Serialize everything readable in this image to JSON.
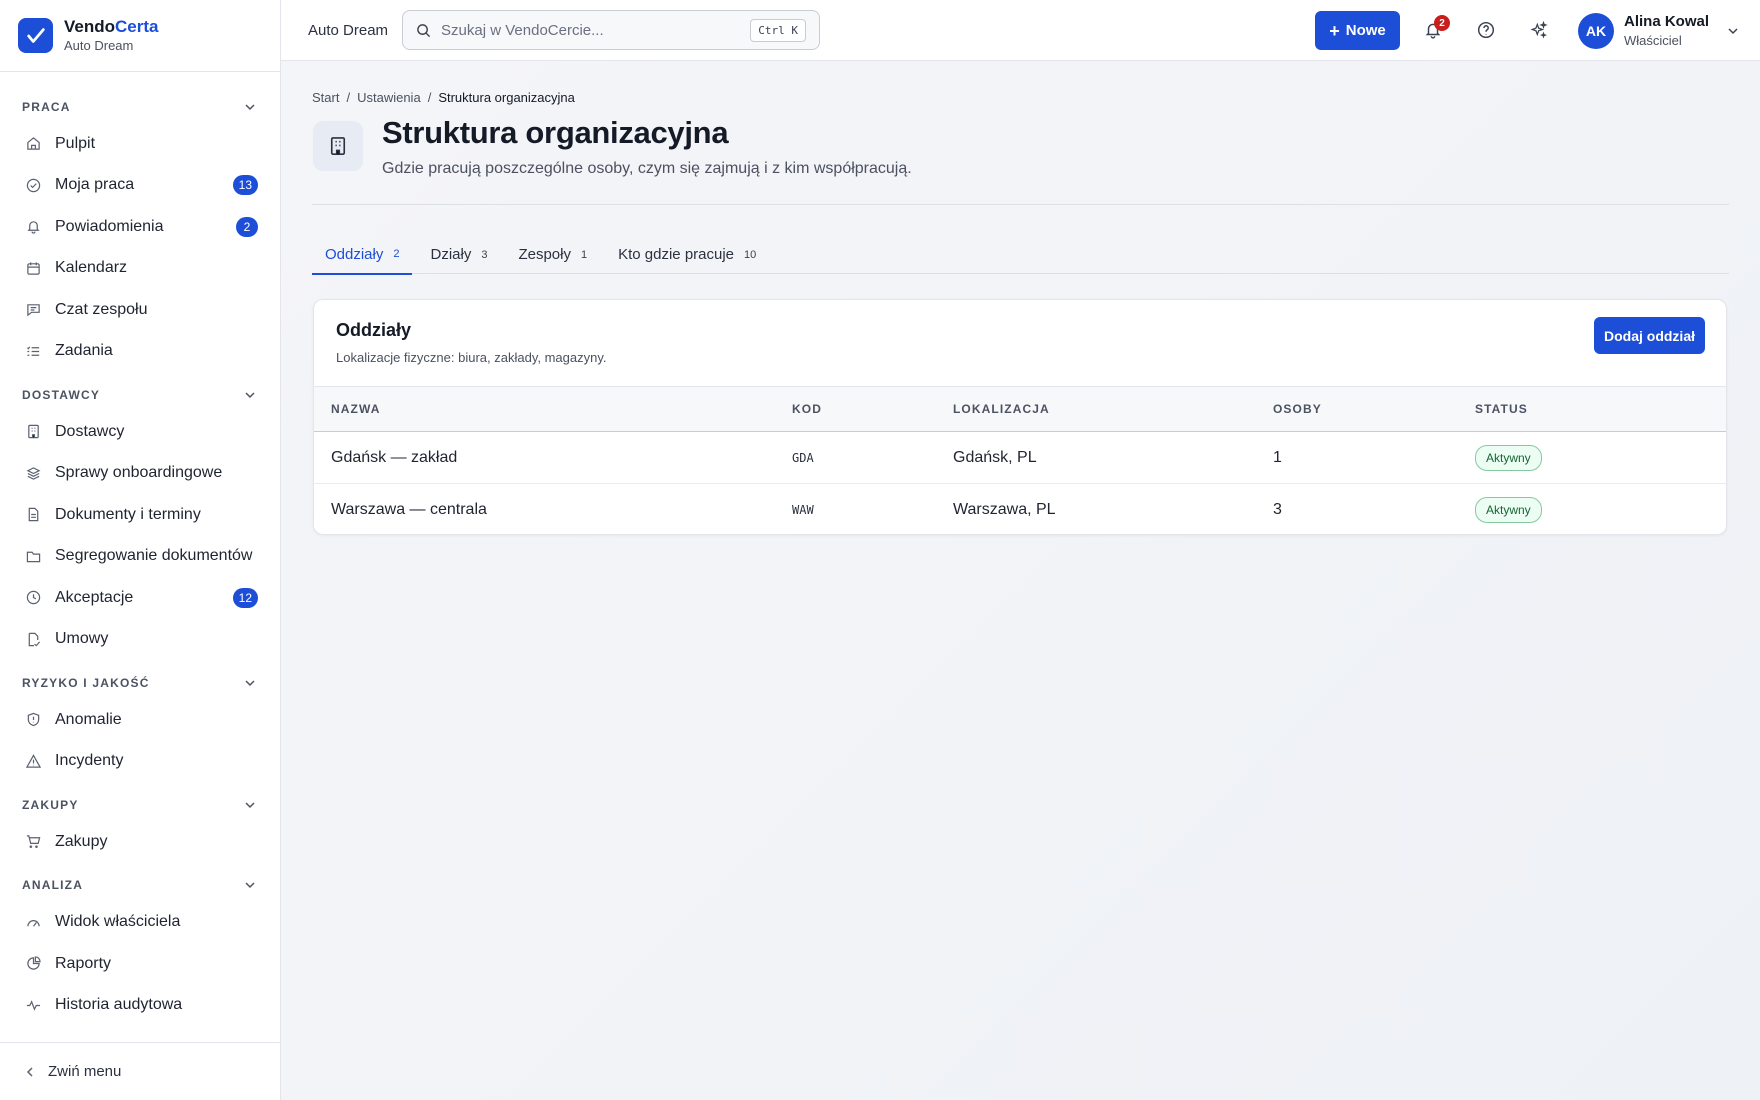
{
  "brand": {
    "name_part1": "Vendo",
    "name_part2": "Certa",
    "org": "Auto Dream"
  },
  "sidebar": {
    "sections": [
      {
        "title": "PRACA",
        "items": [
          {
            "label": "Pulpit",
            "icon": "home-icon"
          },
          {
            "label": "Moja praca",
            "icon": "check-circle-icon",
            "badge": "13"
          },
          {
            "label": "Powiadomienia",
            "icon": "bell-icon",
            "badge": "2"
          },
          {
            "label": "Kalendarz",
            "icon": "calendar-icon"
          },
          {
            "label": "Czat zespołu",
            "icon": "chat-icon"
          },
          {
            "label": "Zadania",
            "icon": "list-check-icon"
          }
        ]
      },
      {
        "title": "DOSTAWCY",
        "items": [
          {
            "label": "Dostawcy",
            "icon": "building-icon"
          },
          {
            "label": "Sprawy onboardingowe",
            "icon": "layers-icon"
          },
          {
            "label": "Dokumenty i terminy",
            "icon": "document-icon"
          },
          {
            "label": "Segregowanie dokumentów",
            "icon": "folder-icon"
          },
          {
            "label": "Akceptacje",
            "icon": "clock-icon",
            "badge": "12"
          },
          {
            "label": "Umowy",
            "icon": "contract-icon"
          }
        ]
      },
      {
        "title": "RYZYKO I JAKOŚĆ",
        "items": [
          {
            "label": "Anomalie",
            "icon": "shield-icon"
          },
          {
            "label": "Incydenty",
            "icon": "warning-icon"
          }
        ]
      },
      {
        "title": "ZAKUPY",
        "items": [
          {
            "label": "Zakupy",
            "icon": "cart-icon"
          }
        ]
      },
      {
        "title": "ANALIZA",
        "items": [
          {
            "label": "Widok właściciela",
            "icon": "gauge-icon"
          },
          {
            "label": "Raporty",
            "icon": "pie-chart-icon"
          },
          {
            "label": "Historia audytowa",
            "icon": "activity-icon"
          }
        ]
      }
    ],
    "collapse_label": "Zwiń menu"
  },
  "topbar": {
    "org": "Auto Dream",
    "search_placeholder": "Szukaj w VendoCercie...",
    "shortcut": "Ctrl K",
    "new_label": "Nowe",
    "notifications_count": "2",
    "user": {
      "initials": "AK",
      "name": "Alina Kowal",
      "role": "Właściciel"
    }
  },
  "page": {
    "breadcrumb": [
      "Start",
      "Ustawienia",
      "Struktura organizacyjna"
    ],
    "title": "Struktura organizacyjna",
    "subtitle": "Gdzie pracują poszczególne osoby, czym się zajmują i z kim współpracują.",
    "tabs": [
      {
        "label": "Oddziały",
        "count": "2"
      },
      {
        "label": "Działy",
        "count": "3"
      },
      {
        "label": "Zespoły",
        "count": "1"
      },
      {
        "label": "Kto gdzie pracuje",
        "count": "10"
      }
    ]
  },
  "card": {
    "title": "Oddziały",
    "subtitle": "Lokalizacje fizyczne: biura, zakłady, magazyny.",
    "add_label": "Dodaj oddział",
    "columns": [
      "NAZWA",
      "KOD",
      "LOKALIZACJA",
      "OSOBY",
      "STATUS"
    ],
    "rows": [
      {
        "name": "Gdańsk — zakład",
        "code": "GDA",
        "location": "Gdańsk, PL",
        "people": "1",
        "status": "Aktywny"
      },
      {
        "name": "Warszawa — centrala",
        "code": "WAW",
        "location": "Warszawa, PL",
        "people": "3",
        "status": "Aktywny"
      }
    ]
  },
  "colors": {
    "accent": "#1d4ed8",
    "status_green": "#166534",
    "alert_red": "#c81e1e"
  }
}
